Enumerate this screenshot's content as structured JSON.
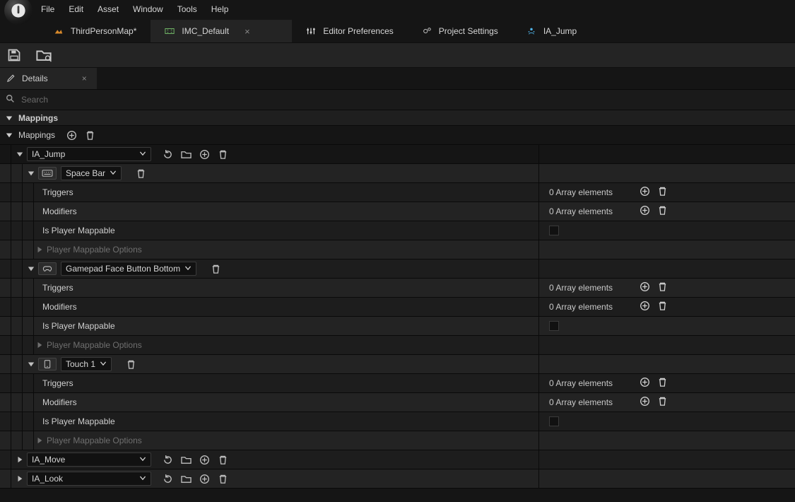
{
  "menu": {
    "items": [
      "File",
      "Edit",
      "Asset",
      "Window",
      "Tools",
      "Help"
    ]
  },
  "tabs": [
    {
      "label": "ThirdPersonMap*",
      "icon": "level",
      "active": false,
      "closable": false
    },
    {
      "label": "IMC_Default",
      "icon": "imc",
      "active": true,
      "closable": true
    },
    {
      "label": "Editor Preferences",
      "icon": "sliders",
      "active": false,
      "closable": false
    },
    {
      "label": "Project Settings",
      "icon": "gears",
      "active": false,
      "closable": false
    },
    {
      "label": "IA_Jump",
      "icon": "ia",
      "active": false,
      "closable": false
    }
  ],
  "panel": {
    "title": "Details"
  },
  "search": {
    "placeholder": "Search"
  },
  "sections": {
    "root": "Mappings",
    "array": "Mappings"
  },
  "actions": [
    {
      "name": "IA_Jump",
      "expanded": true,
      "bindings": [
        {
          "device": "keyboard",
          "key": "Space Bar",
          "expanded": true,
          "props": [
            {
              "label": "Triggers",
              "value": "0 Array elements",
              "type": "array"
            },
            {
              "label": "Modifiers",
              "value": "0 Array elements",
              "type": "array"
            },
            {
              "label": "Is Player Mappable",
              "type": "check"
            },
            {
              "label": "Player Mappable Options",
              "type": "sub",
              "muted": true
            }
          ]
        },
        {
          "device": "gamepad",
          "key": "Gamepad Face Button Bottom",
          "expanded": true,
          "props": [
            {
              "label": "Triggers",
              "value": "0 Array elements",
              "type": "array"
            },
            {
              "label": "Modifiers",
              "value": "0 Array elements",
              "type": "array"
            },
            {
              "label": "Is Player Mappable",
              "type": "check"
            },
            {
              "label": "Player Mappable Options",
              "type": "sub",
              "muted": true
            }
          ]
        },
        {
          "device": "touch",
          "key": "Touch 1",
          "expanded": true,
          "props": [
            {
              "label": "Triggers",
              "value": "0 Array elements",
              "type": "array"
            },
            {
              "label": "Modifiers",
              "value": "0 Array elements",
              "type": "array"
            },
            {
              "label": "Is Player Mappable",
              "type": "check"
            },
            {
              "label": "Player Mappable Options",
              "type": "sub",
              "muted": true
            }
          ]
        }
      ]
    },
    {
      "name": "IA_Move",
      "expanded": false
    },
    {
      "name": "IA_Look",
      "expanded": false
    }
  ]
}
